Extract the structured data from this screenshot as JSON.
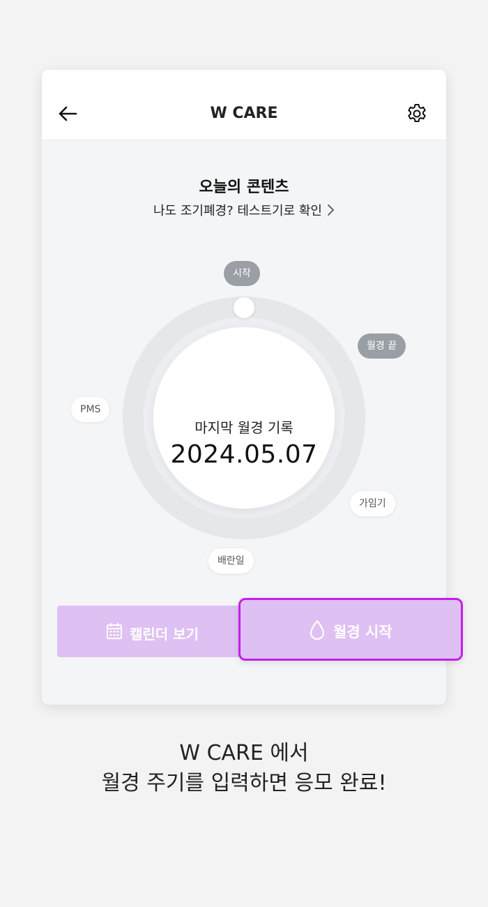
{
  "header": {
    "title": "W CARE",
    "back_icon": "arrow-left-icon",
    "settings_icon": "gear-icon"
  },
  "content": {
    "title": "오늘의 콘텐츠",
    "link_text": "나도 조기폐경? 테스트기로 확인"
  },
  "cycle": {
    "center_label": "마지막 월경 기록",
    "last_period_date": "2024.05.07",
    "phases": {
      "start": "시작",
      "period_end": "월경 끝",
      "fertile": "가임기",
      "ovulation": "배란일",
      "pms": "PMS"
    }
  },
  "actions": {
    "calendar_label": "캘린더 보기",
    "calendar_icon": "calendar-icon",
    "start_label": "월경 시작",
    "start_icon": "drop-icon"
  },
  "caption": {
    "line1": "W CARE 에서",
    "line2": "월경 주기를 입력하면 응모 완료!"
  },
  "colors": {
    "accent": "#dfc0f3",
    "highlight_border": "#c31fe8",
    "phase_dark": "#9a9ea5"
  }
}
